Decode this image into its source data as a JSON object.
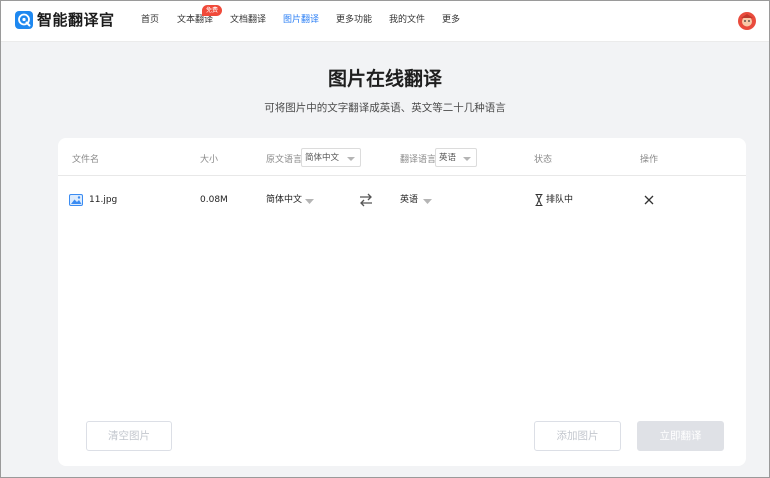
{
  "app": {
    "name": "智能翻译官"
  },
  "nav": {
    "home": "首页",
    "text_translate": "文本翻译",
    "text_badge": "免费",
    "doc_translate": "文档翻译",
    "image_translate": "图片翻译",
    "more_features": "更多功能",
    "my_files": "我的文件",
    "more": "更多"
  },
  "page": {
    "title": "图片在线翻译",
    "subtitle": "可将图片中的文字翻译成英语、英文等二十几种语言"
  },
  "table": {
    "headers": {
      "filename": "文件名",
      "size": "大小",
      "source_lang": "原文语言",
      "target_lang": "翻译语言",
      "status": "状态",
      "action": "操作"
    },
    "header_source_value": "简体中文",
    "header_target_value": "英语",
    "rows": [
      {
        "filename": "11.jpg",
        "size": "0.08M",
        "source_lang": "简体中文",
        "target_lang": "英语",
        "status": "排队中"
      }
    ]
  },
  "buttons": {
    "clear": "清空图片",
    "add": "添加图片",
    "translate": "立即翻译"
  },
  "colors": {
    "accent": "#2b7ff5",
    "badge": "#f04a3a",
    "disabled_primary": "#dfe1e6"
  },
  "icons": {
    "logo": "translate-logo-icon",
    "avatar": "avatar-icon",
    "file": "image-file-icon",
    "swap": "swap-arrows-icon",
    "status": "hourglass-icon",
    "delete": "close-icon"
  }
}
